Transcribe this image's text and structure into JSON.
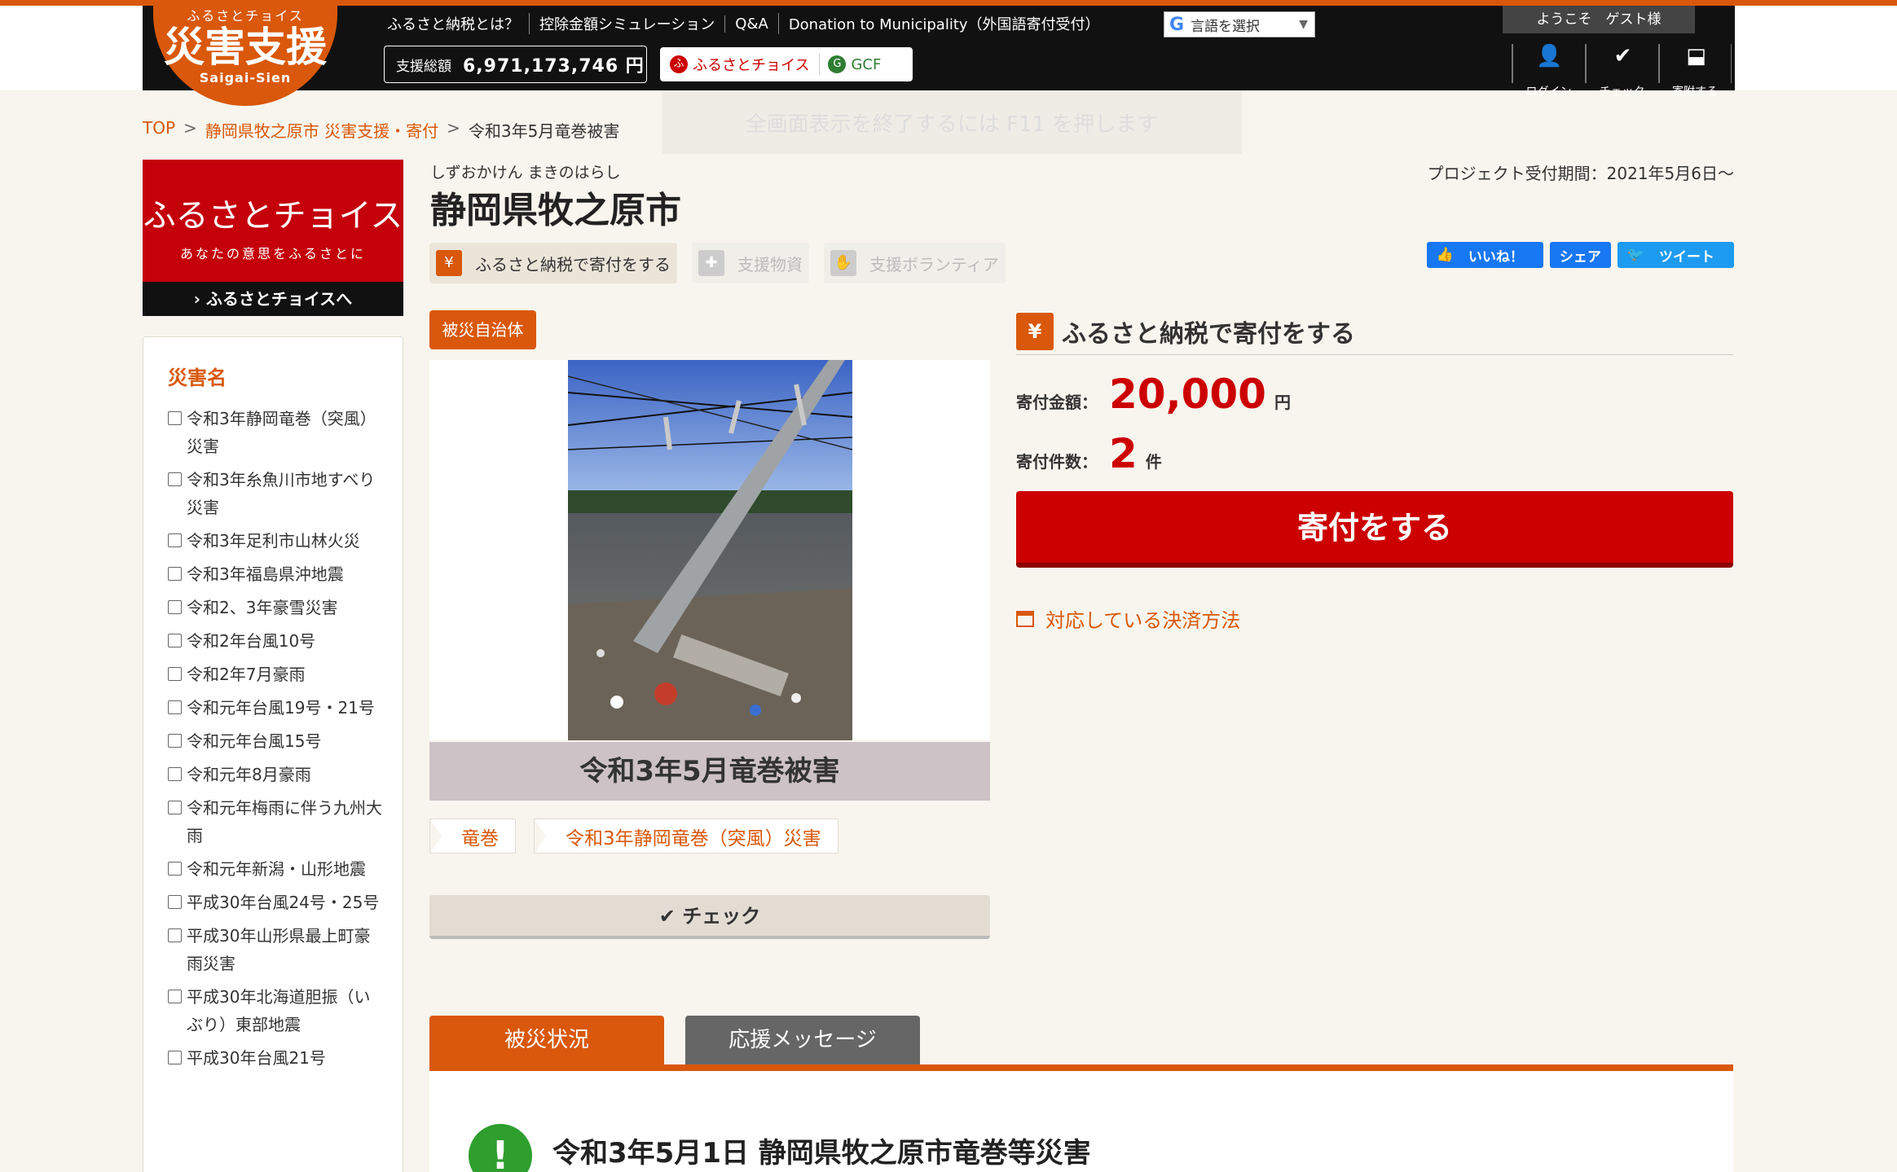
{
  "header": {
    "logo_small": "ふるさとチョイス",
    "logo_big": "災害支援",
    "logo_en": "Saigai-Sien",
    "nav": [
      "ふるさと納税とは？",
      "控除金額シミュレーション",
      "Q&A",
      "Donation to Municipality（外国語寄付受付）"
    ],
    "lang_label": "言語を選択",
    "total_label": "支援総額",
    "total_value": "6,971,173,746 円",
    "brand_fc": "ふるさとチョイス",
    "brand_gcf": "GCF",
    "welcome": "ようこそ　ゲスト様",
    "user_links": [
      "ログイン",
      "チェック",
      "寄附する"
    ]
  },
  "fullscreen_notice": "全画面表示を終了するには F11 を押します",
  "breadcrumb": [
    "TOP",
    "静岡県牧之原市 災害支援・寄付",
    "令和3年5月竜巻被害"
  ],
  "sidebar": {
    "banner_title": "ふるさとチョイス",
    "banner_sub": "あなたの意思をふるさとに",
    "banner_btn": "› ふるさとチョイスへ",
    "disaster_heading": "災害名",
    "disasters": [
      "令和3年静岡竜巻（突風）災害",
      "令和3年糸魚川市地すべり災害",
      "令和3年足利市山林火災",
      "令和3年福島県沖地震",
      "令和2、3年豪雪災害",
      "令和2年台風10号",
      "令和2年7月豪雨",
      "令和元年台風19号・21号",
      "令和元年台風15号",
      "令和元年8月豪雨",
      "令和元年梅雨に伴う九州大雨",
      "令和元年新潟・山形地震",
      "平成30年台風24号・25号",
      "平成30年山形県最上町豪雨災害",
      "平成30年北海道胆振（いぶり）東部地震",
      "平成30年台風21号"
    ]
  },
  "main": {
    "kana": "しずおかけん まきのはらし",
    "title": "静岡県牧之原市",
    "period": "プロジェクト受付期間：2021年5月6日～",
    "tabs": [
      "ふるさと納税で寄付をする",
      "支援物資",
      "支援ボランティア"
    ],
    "social": [
      "いいね！",
      "シェア",
      "ツイート"
    ],
    "badge": "被災自治体",
    "caption": "令和3年5月竜巻被害",
    "tags": [
      "竜巻",
      "令和3年静岡竜巻（突風）災害"
    ],
    "check_label": "✔ チェック"
  },
  "donation": {
    "title": "ふるさと納税で寄付をする",
    "amount_label": "寄付金額：",
    "amount_value": "20,000",
    "amount_unit": "円",
    "count_label": "寄付件数：",
    "count_value": "2",
    "count_unit": "件",
    "button": "寄付をする",
    "payment_link": "対応している決済方法"
  },
  "bottom_tabs": [
    "被災状況",
    "応援メッセージ"
  ],
  "content_title": "令和3年5月1日 静岡県牧之原市竜巻等災害",
  "colors": {
    "accent": "#d9580b",
    "donate_red": "#cc0000"
  }
}
